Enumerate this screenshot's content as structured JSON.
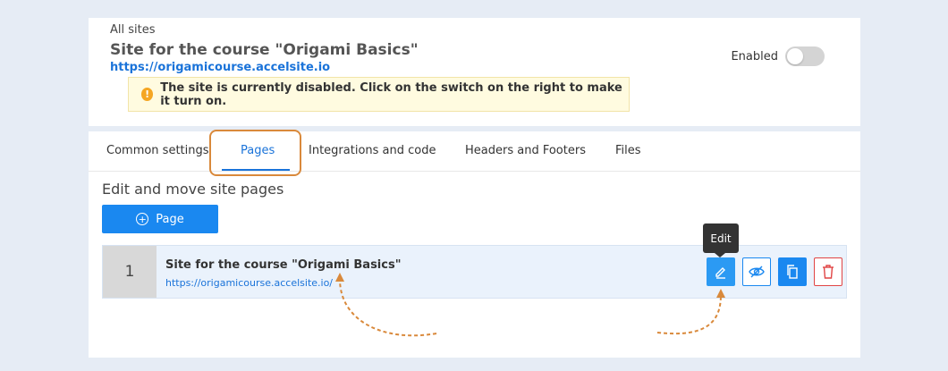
{
  "header": {
    "breadcrumb": "All sites",
    "site_title": "Site for the course \"Origami Basics\"",
    "site_url": "https://origamicourse.accelsite.io",
    "enabled_label": "Enabled",
    "enabled": false,
    "alert_icon": "!",
    "alert_text": "The site is currently disabled. Click on the switch on the right to make it turn on."
  },
  "tabs": [
    {
      "label": "Common settings",
      "active": false
    },
    {
      "label": "Pages",
      "active": true
    },
    {
      "label": "Integrations and code",
      "active": false
    },
    {
      "label": "Headers and Footers",
      "active": false
    },
    {
      "label": "Files",
      "active": false
    }
  ],
  "main": {
    "section_title": "Edit and move site pages",
    "add_page_label": "Page",
    "add_page_icon": "plus-circle-icon",
    "pages": [
      {
        "number": "1",
        "title": "Site for the course \"Origami Basics\"",
        "url": "https://origamicourse.accelsite.io/"
      }
    ],
    "tooltip": "Edit"
  },
  "colors": {
    "accent": "#1a88f0",
    "danger": "#e04444",
    "highlight": "#d9893b",
    "alert_bg": "#fffbe0"
  }
}
